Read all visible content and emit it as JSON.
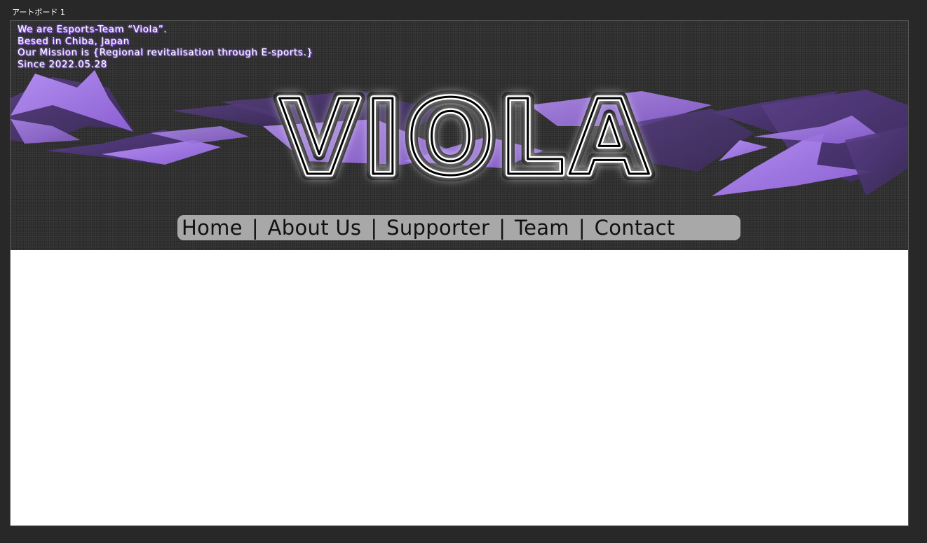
{
  "artboard": {
    "label": "アートボード 1"
  },
  "header": {
    "intro_lines": [
      "We are Esports-Team “Viola”.",
      "Besed in Chiba, Japan",
      "Our Mission is {Regional revitalisation through E-sports.}",
      "Since 2022.05.28"
    ],
    "logo_text": "VIOLA"
  },
  "nav": {
    "items": [
      "Home",
      "About Us",
      "Supporter",
      "Team",
      "Contact"
    ],
    "separator": "|"
  },
  "colors": {
    "background": "#282828",
    "header_bg": "#2e2e2e",
    "accent_purple": "#9b72d9",
    "dark_purple": "#4a3470",
    "nav_bg": "#a8a8a8"
  }
}
